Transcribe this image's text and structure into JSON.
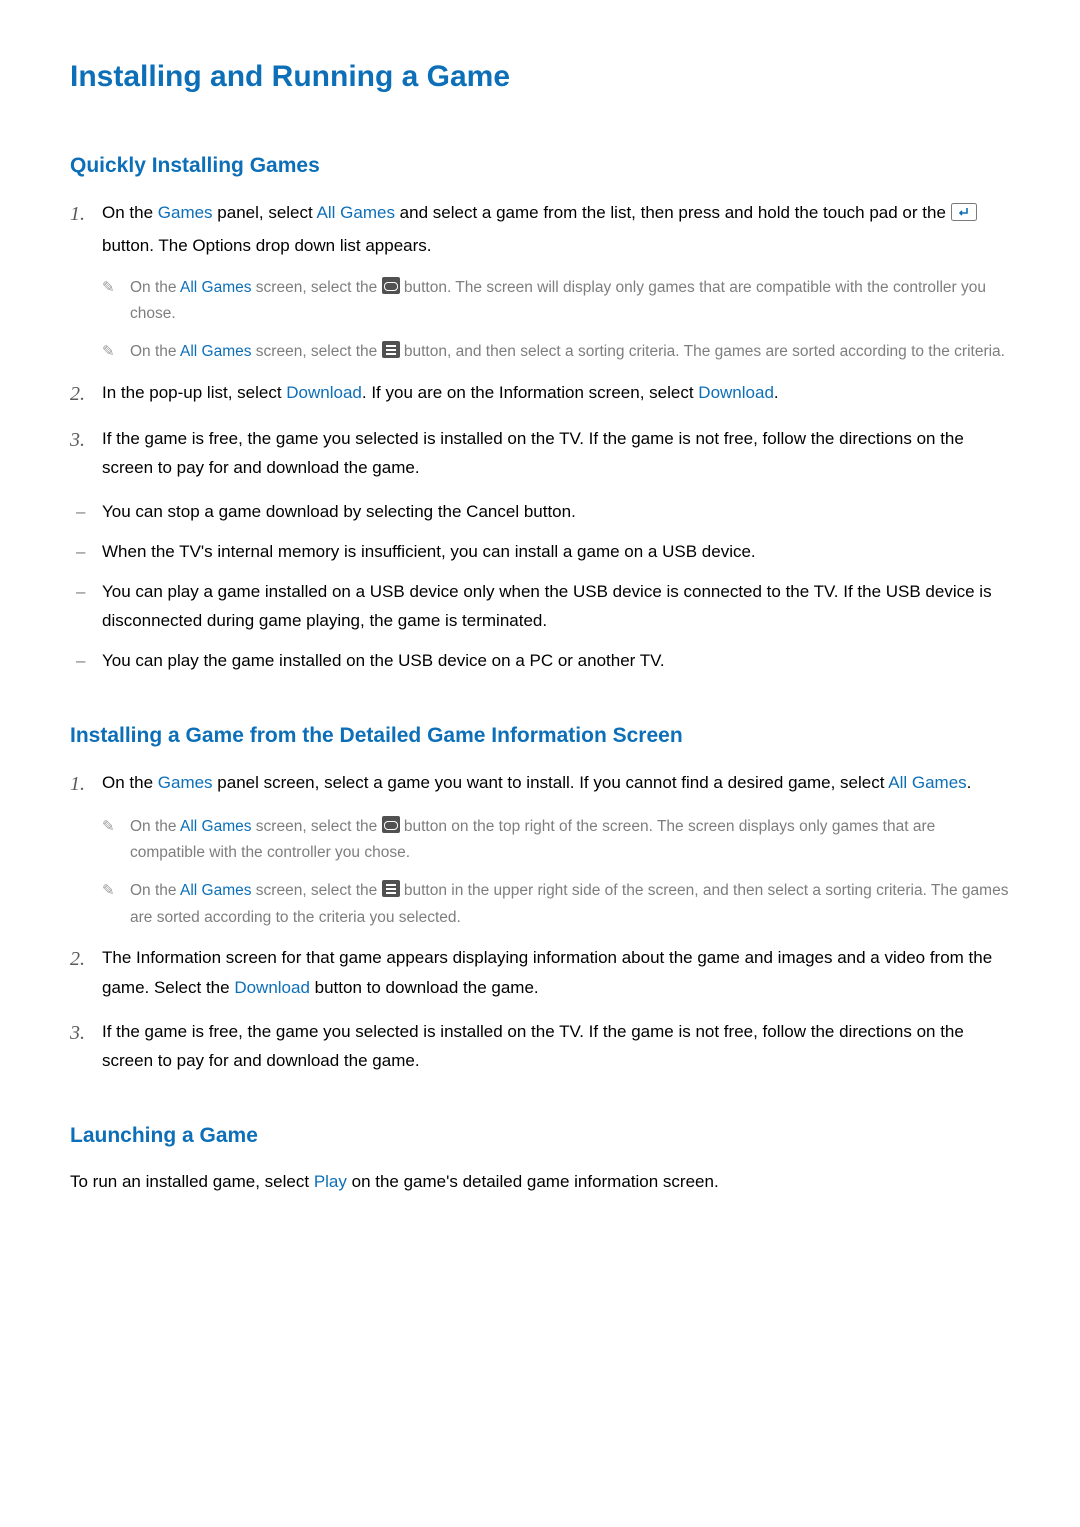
{
  "title": "Installing and Running a Game",
  "section1": {
    "heading": "Quickly Installing Games",
    "step1": {
      "num": "1.",
      "t1": "On the ",
      "hl1": "Games",
      "t2": " panel, select ",
      "hl2": "All Games",
      "t3": " and select a game from the list, then press and hold the touch pad or the ",
      "t4": " button. The Options drop down list appears."
    },
    "note1a": {
      "t1": "On the ",
      "hl1": "All Games",
      "t2": " screen, select the ",
      "t3": " button. The screen will display only games that are compatible with the controller you chose."
    },
    "note1b": {
      "t1": "On the ",
      "hl1": "All Games",
      "t2": " screen, select the ",
      "t3": " button, and then select a sorting criteria. The games are sorted according to the criteria."
    },
    "step2": {
      "num": "2.",
      "t1": "In the pop-up list, select ",
      "hl1": "Download",
      "t2": ". If you are on the Information screen, select ",
      "hl2": "Download",
      "t3": "."
    },
    "step3": {
      "num": "3.",
      "t1": "If the game is free, the game you selected is installed on the TV. If the game is not free, follow the directions on the screen to pay for and download the game."
    },
    "bullets": [
      "You can stop a game download by selecting the Cancel button.",
      "When the TV's internal memory is insufficient, you can install a game on a USB device.",
      "You can play a game installed on a USB device only when the USB device is connected to the TV. If the USB device is disconnected during game playing, the game is terminated.",
      "You can play the game installed on the USB device on a PC or another TV."
    ]
  },
  "section2": {
    "heading": "Installing a Game from the Detailed Game Information Screen",
    "step1": {
      "num": "1.",
      "t1": "On the ",
      "hl1": "Games",
      "t2": " panel screen, select a game you want to install. If you cannot find a desired game, select ",
      "hl2": "All Games",
      "t3": "."
    },
    "note2a": {
      "t1": "On the ",
      "hl1": "All Games",
      "t2": " screen, select the ",
      "t3": " button on the top right of the screen. The screen displays only games that are compatible with the controller you chose."
    },
    "note2b": {
      "t1": "On the ",
      "hl1": "All Games",
      "t2": " screen, select the ",
      "t3": " button in the upper right side of the screen, and then select a sorting criteria. The games are sorted according to the criteria you selected."
    },
    "step2": {
      "num": "2.",
      "t1": "The Information screen for that game appears displaying information about the game and images and a video from the game. Select the ",
      "hl1": "Download",
      "t2": " button to download the game."
    },
    "step3": {
      "num": "3.",
      "t1": "If the game is free, the game you selected is installed on the TV. If the game is not free, follow the directions on the screen to pay for and download the game."
    }
  },
  "section3": {
    "heading": "Launching a Game",
    "para": {
      "t1": "To run an installed game, select ",
      "hl1": "Play",
      "t2": " on the game's detailed game information screen."
    }
  }
}
